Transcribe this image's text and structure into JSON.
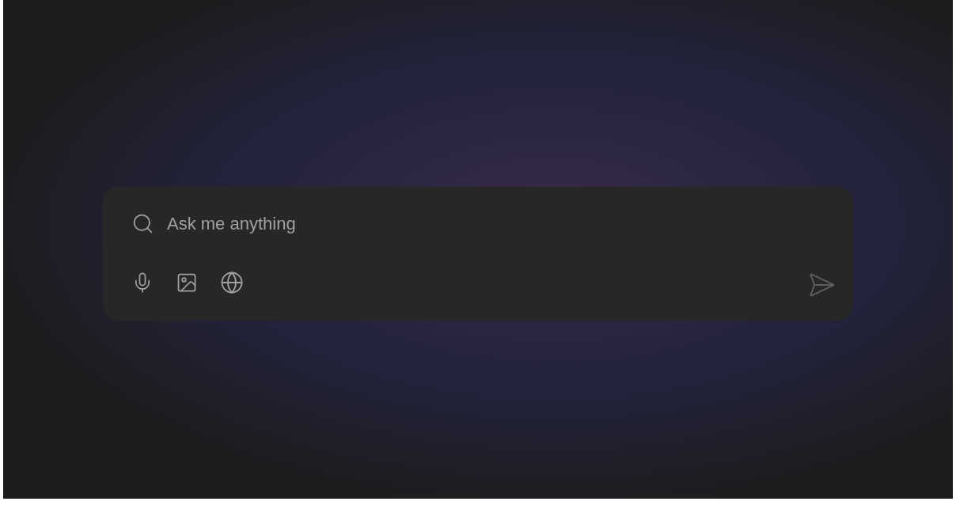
{
  "search": {
    "placeholder": "Ask me anything"
  },
  "send_button": {
    "disabled": true
  }
}
